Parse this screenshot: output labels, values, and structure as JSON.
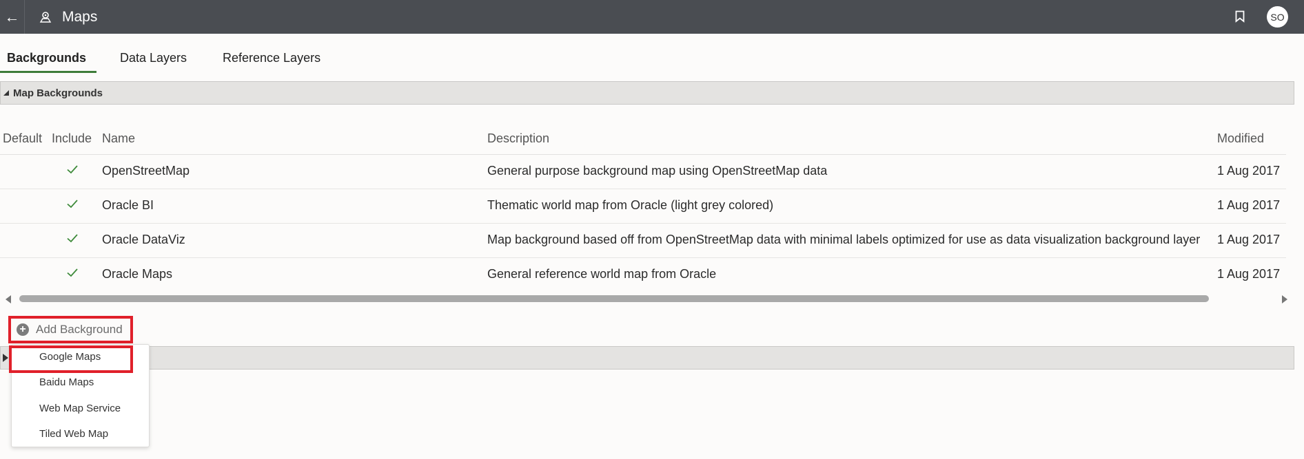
{
  "header": {
    "back_icon": "←",
    "title": "Maps",
    "avatar_initials": "SO"
  },
  "tabs": [
    {
      "label": "Backgrounds",
      "active": true
    },
    {
      "label": "Data Layers",
      "active": false
    },
    {
      "label": "Reference Layers",
      "active": false
    }
  ],
  "sections": {
    "map_backgrounds": "Map Backgrounds"
  },
  "table": {
    "columns": [
      "Default",
      "Include",
      "Name",
      "Description",
      "Modified"
    ],
    "rows": [
      {
        "include": true,
        "name": "OpenStreetMap",
        "description": "General purpose background map using OpenStreetMap data",
        "modified": "1 Aug 2017"
      },
      {
        "include": true,
        "name": "Oracle BI",
        "description": "Thematic world map from Oracle (light grey colored)",
        "modified": "1 Aug 2017"
      },
      {
        "include": true,
        "name": "Oracle DataViz",
        "description": "Map background based off from OpenStreetMap data with minimal labels optimized for use as data visualization background layer",
        "modified": "1 Aug 2017"
      },
      {
        "include": true,
        "name": "Oracle Maps",
        "description": "General reference world map from Oracle",
        "modified": "1 Aug 2017"
      }
    ]
  },
  "add_background": {
    "icon": "+",
    "label": "Add Background"
  },
  "menu": {
    "items": [
      "Google Maps",
      "Baidu Maps",
      "Web Map Service",
      "Tiled Web Map"
    ]
  },
  "colors": {
    "header_bg": "#4a4d52",
    "tab_active_underline": "#3e7c3a",
    "check": "#3e8a3a",
    "highlight_box": "#e0202a"
  }
}
